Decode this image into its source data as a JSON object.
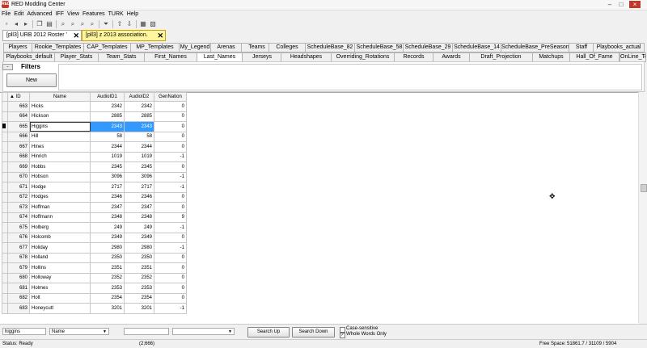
{
  "window": {
    "title": "RED Modding Center",
    "app_icon": "RED"
  },
  "menu": [
    "File",
    "Edit",
    "Advanced",
    "IFF",
    "View",
    "Features",
    "TURK",
    "Help"
  ],
  "doc_tabs": [
    {
      "label": "[pll3] URB 2012 Roster '",
      "active": false
    },
    {
      "label": "[pll3] z 2013 association.",
      "active": true
    }
  ],
  "subtabs_row1": [
    "Players",
    "Rookie_Templates",
    "CAP_Templates",
    "MP_Templates",
    "My_Legend",
    "Arenas",
    "Teams",
    "Colleges",
    "ScheduleBase_82",
    "ScheduleBase_58",
    "ScheduleBase_29",
    "ScheduleBase_14",
    "ScheduleBase_PreSeason",
    "Staff",
    "Playbooks_actual"
  ],
  "subtabs_row2": [
    "Playbooks_default",
    "Player_Stats",
    "Team_Stats",
    "First_Names",
    "Last_Names",
    "Jerseys",
    "Headshapes",
    "Overriding_Rotations",
    "Records",
    "Awards",
    "Draft_Projection",
    "Matchups",
    "Hall_Of_Fame",
    "OnLine_TeamUp"
  ],
  "active_subtab": "Last_Names",
  "filters": {
    "toggle_label": "-",
    "label": "Filters",
    "new_button": "New"
  },
  "grid": {
    "sort_arrow": "▲",
    "columns": [
      "ID",
      "Name",
      "AudioID1",
      "AudioID2",
      "GenNation"
    ],
    "rows": [
      [
        "663",
        "Hicks",
        "2342",
        "2342",
        "0"
      ],
      [
        "664",
        "Hickson",
        "2885",
        "2885",
        "0"
      ],
      [
        "665",
        "Higgins",
        "2343",
        "2343",
        "0"
      ],
      [
        "666",
        "Hill",
        "58",
        "58",
        "0"
      ],
      [
        "667",
        "Hines",
        "2344",
        "2344",
        "0"
      ],
      [
        "668",
        "Hinrich",
        "1019",
        "1019",
        "-1"
      ],
      [
        "669",
        "Hobbs",
        "2345",
        "2345",
        "0"
      ],
      [
        "670",
        "Hobson",
        "3096",
        "3096",
        "-1"
      ],
      [
        "671",
        "Hodge",
        "2717",
        "2717",
        "-1"
      ],
      [
        "672",
        "Hodges",
        "2346",
        "2346",
        "0"
      ],
      [
        "673",
        "Hoffman",
        "2347",
        "2347",
        "0"
      ],
      [
        "674",
        "Hoffmann",
        "2348",
        "2348",
        "9"
      ],
      [
        "675",
        "Holberg",
        "249",
        "249",
        "-1"
      ],
      [
        "676",
        "Holcomb",
        "2349",
        "2349",
        "0"
      ],
      [
        "677",
        "Holiday",
        "2980",
        "2980",
        "-1"
      ],
      [
        "678",
        "Holland",
        "2350",
        "2350",
        "0"
      ],
      [
        "679",
        "Hollins",
        "2351",
        "2351",
        "0"
      ],
      [
        "680",
        "Holloway",
        "2352",
        "2352",
        "0"
      ],
      [
        "681",
        "Holmes",
        "2353",
        "2353",
        "0"
      ],
      [
        "682",
        "Holt",
        "2354",
        "2354",
        "0"
      ],
      [
        "683",
        "Honeycutt",
        "3201",
        "3201",
        "-1"
      ]
    ],
    "selected_row_index": 2
  },
  "search": {
    "query": "higgins",
    "field": "Name",
    "value2": "",
    "value3": "",
    "search_up": "Search Up",
    "search_down": "Search Down",
    "case_sensitive": "Case-sensitive",
    "case_sensitive_checked": false,
    "whole_words": "Whole Words Only",
    "whole_words_checked": true
  },
  "status": {
    "status": "Status:  Ready",
    "position": "(2;666)",
    "free_space_label": "Free Space:",
    "free_space_value": "51861.7 / 31109 / 5904"
  }
}
